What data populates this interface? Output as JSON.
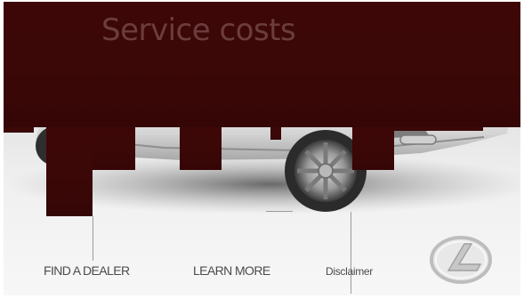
{
  "header": {
    "title": "Service costs"
  },
  "footer": {
    "find_dealer_label": "FIND A DEALER",
    "learn_more_label": "LEARN MORE",
    "disclaimer_label": "Disclaimer"
  },
  "brand": {
    "logo_name": "lexus-logo",
    "accent_color": "#3e0707",
    "text_color": "#4b4b4b"
  }
}
